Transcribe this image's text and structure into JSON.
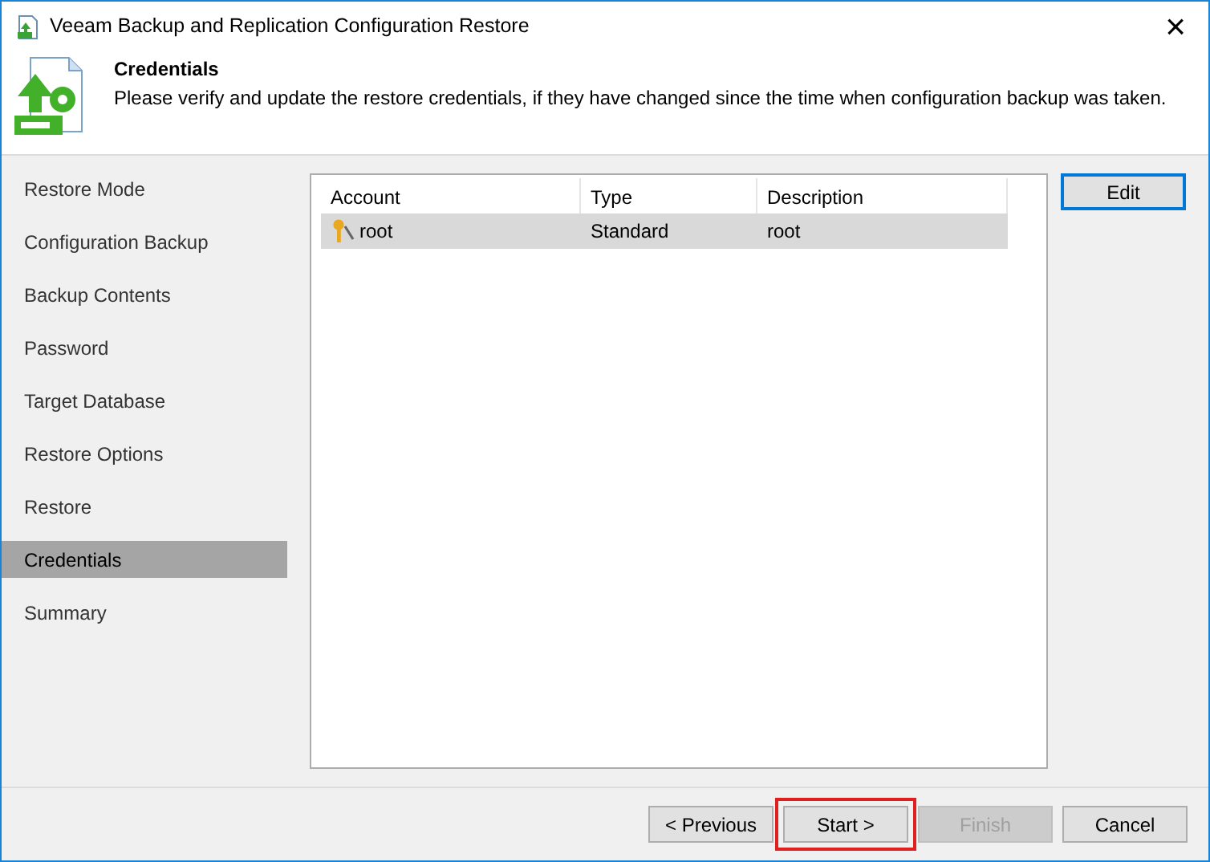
{
  "window": {
    "title": "Veeam Backup and Replication Configuration Restore",
    "close": "×"
  },
  "header": {
    "title": "Credentials",
    "description": "Please verify and update the restore credentials, if they have changed since the time when configuration backup was taken."
  },
  "sidebar": {
    "items": [
      {
        "label": "Restore Mode",
        "selected": false
      },
      {
        "label": "Configuration Backup",
        "selected": false
      },
      {
        "label": "Backup Contents",
        "selected": false
      },
      {
        "label": "Password",
        "selected": false
      },
      {
        "label": "Target Database",
        "selected": false
      },
      {
        "label": "Restore Options",
        "selected": false
      },
      {
        "label": "Restore",
        "selected": false
      },
      {
        "label": "Credentials",
        "selected": true
      },
      {
        "label": "Summary",
        "selected": false
      }
    ]
  },
  "table": {
    "columns": [
      "Account",
      "Type",
      "Description"
    ],
    "rows": [
      {
        "cells": [
          "root",
          "Standard",
          "root"
        ],
        "selected": true
      }
    ]
  },
  "side_buttons": [
    {
      "label": "Edit",
      "disabled": false
    }
  ],
  "buttons": [
    {
      "label": "< Previous",
      "disabled": false,
      "highlighted": false
    },
    {
      "label": "Start >",
      "disabled": false,
      "highlighted": true
    },
    {
      "label": "Finish",
      "disabled": true,
      "highlighted": false
    },
    {
      "label": "Cancel",
      "disabled": false,
      "highlighted": false
    }
  ]
}
